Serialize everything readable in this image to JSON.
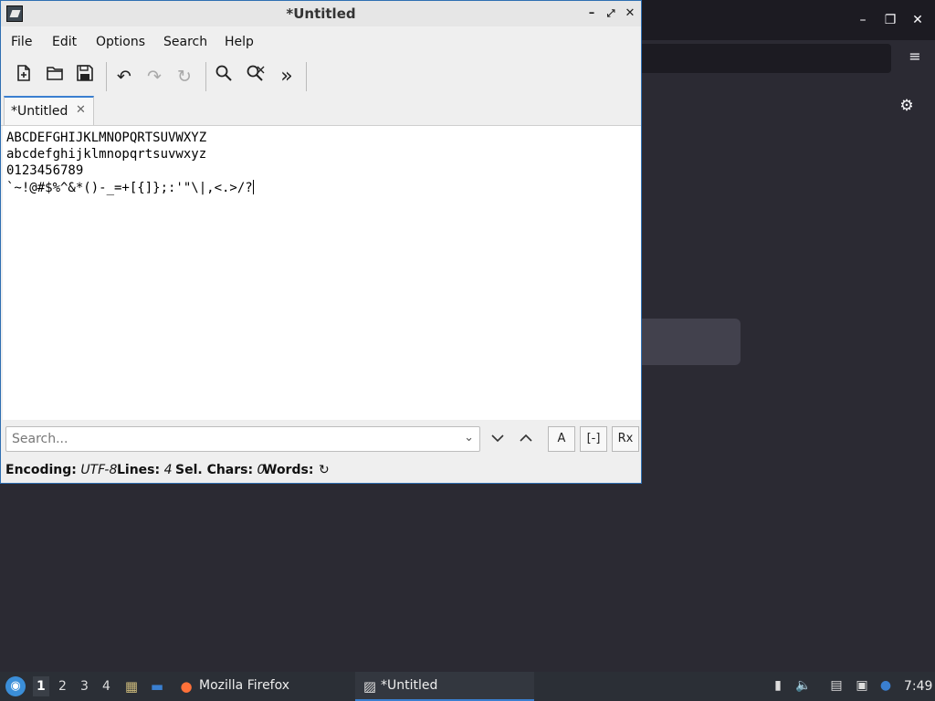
{
  "window": {
    "title": "*Untitled"
  },
  "menu": [
    "File",
    "Edit",
    "Options",
    "Search",
    "Help"
  ],
  "toolbar": {
    "new": "new-file-icon",
    "open": "open-folder-icon",
    "save": "save-icon",
    "undo": "undo-icon",
    "redo": "redo-icon",
    "reload": "reload-icon",
    "find": "find-icon",
    "replace": "find-replace-icon",
    "more": "more-icon"
  },
  "tab": {
    "label": "*Untitled",
    "close": "✕"
  },
  "editor": {
    "lines": [
      "ABCDEFGHIJKLMNOPQRTSUVWXYZ",
      "abcdefghijklmnopqrtsuvwxyz",
      "0123456789",
      "`~!@#$%^&*()-_=+[{]};:'\"\\|,<.>/?"
    ]
  },
  "search": {
    "placeholder": "Search...",
    "case_btn": "A",
    "whole_btn": "[-]",
    "regex_btn": "Rx"
  },
  "status": {
    "encoding_label": "Encoding:",
    "encoding_value": "UTF-8",
    "lines_label": "Lines:",
    "lines_value": "4",
    "sel_label": "Sel. Chars:",
    "sel_value": "0",
    "words_label": "Words:"
  },
  "taskbar": {
    "workspaces": [
      "1",
      "2",
      "3",
      "4"
    ],
    "tasks": [
      {
        "label": "Mozilla Firefox"
      },
      {
        "label": "*Untitled"
      }
    ],
    "clock": "7:49"
  },
  "colors": {
    "accent": "#3a7fd0",
    "taskbar": "#2b2f36",
    "desktop": "#2b2a33"
  }
}
